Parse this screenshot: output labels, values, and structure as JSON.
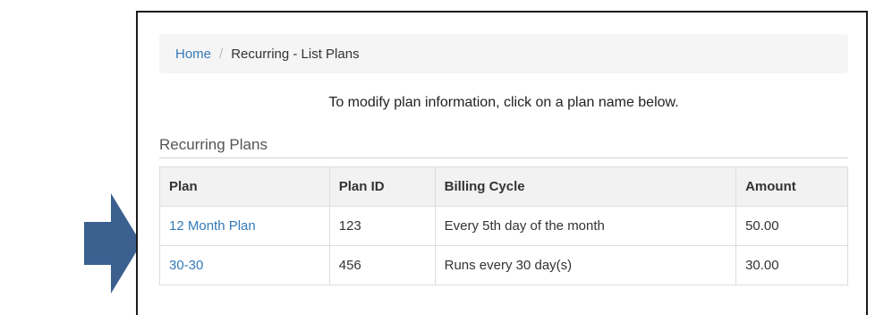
{
  "breadcrumb": {
    "home": "Home",
    "separator": "/",
    "current": "Recurring - List Plans"
  },
  "instruction": "To modify plan information, click on a plan name below.",
  "section_title": "Recurring Plans",
  "table": {
    "headers": [
      "Plan",
      "Plan ID",
      "Billing Cycle",
      "Amount"
    ],
    "rows": [
      {
        "plan": "12 Month Plan",
        "plan_id": "123",
        "billing_cycle": "Every 5th day of the month",
        "amount": "50.00"
      },
      {
        "plan": "30-30",
        "plan_id": "456",
        "billing_cycle": "Runs every 30 day(s)",
        "amount": "30.00"
      }
    ]
  },
  "colors": {
    "arrow": "#3b5f8f",
    "link": "#337ab7",
    "header_bg": "#f2f2f2",
    "breadcrumb_bg": "#f5f5f5"
  },
  "icons": {
    "pointer": "right-arrow-icon"
  }
}
